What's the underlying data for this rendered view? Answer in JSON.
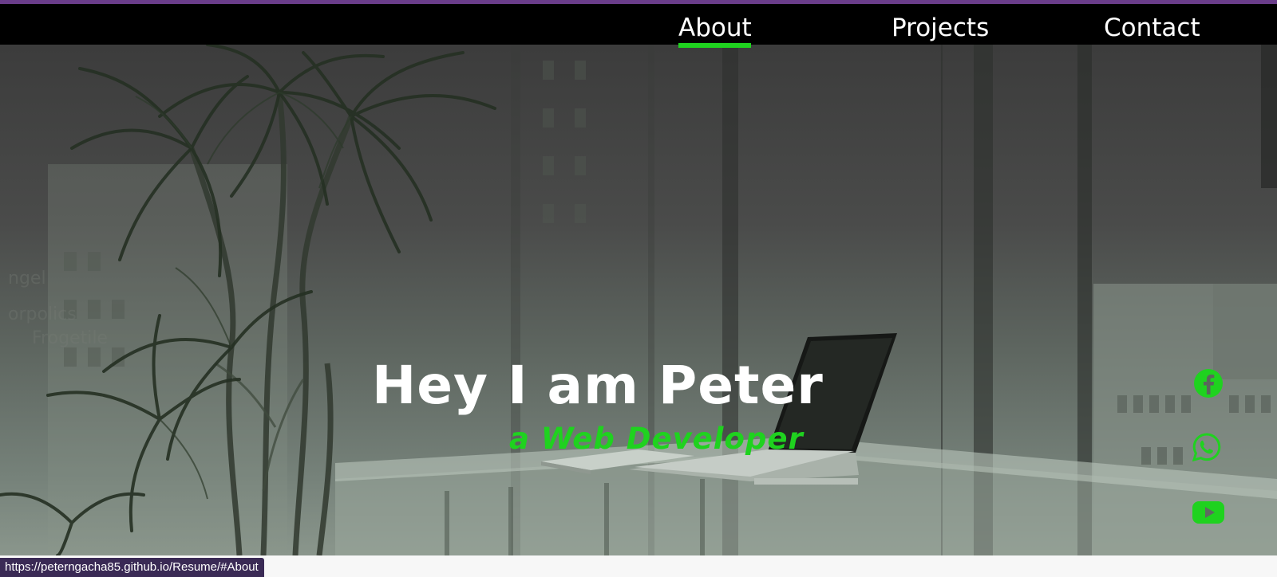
{
  "nav": {
    "links": [
      {
        "label": "About",
        "active": true
      },
      {
        "label": "Projects",
        "active": false
      },
      {
        "label": "Contact",
        "active": false
      }
    ]
  },
  "hero": {
    "title": "Hey I am Peter",
    "subtitle": "a Web Developer"
  },
  "social": {
    "icons": [
      "facebook-icon",
      "whatsapp-icon",
      "youtube-icon"
    ]
  },
  "status_bar": {
    "url": "https://peterngacha85.github.io/Resume/#About"
  },
  "colors": {
    "accent_green": "#1fd21f",
    "navbar_bg": "#000000",
    "top_strip": "#6a3d8a",
    "status_bg": "#3a2a55"
  }
}
